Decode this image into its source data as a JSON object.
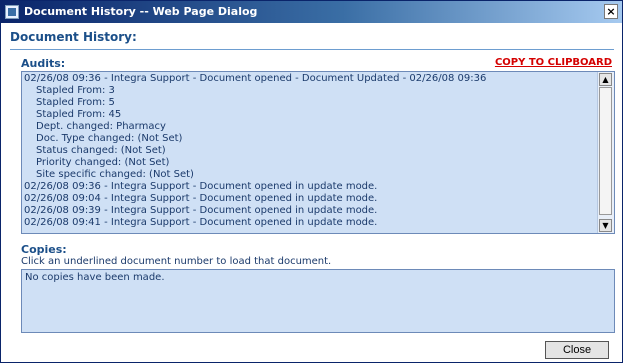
{
  "window": {
    "title": "Document History -- Web Page Dialog",
    "close_glyph": "×"
  },
  "heading": "Document History:",
  "audits": {
    "label": "Audits:",
    "copy_link": "COPY TO CLIPBOARD",
    "lines": [
      {
        "text": "02/26/08 09:36  -  Integra Support  -  Document opened  -  Document Updated  -  02/26/08 09:36",
        "indent": false
      },
      {
        "text": "Stapled From:   3",
        "indent": true
      },
      {
        "text": "Stapled From:   5",
        "indent": true
      },
      {
        "text": "Stapled From:   45",
        "indent": true
      },
      {
        "text": "Dept. changed:  Pharmacy",
        "indent": true
      },
      {
        "text": "Doc. Type changed:  (Not Set)",
        "indent": true
      },
      {
        "text": "Status changed:  (Not Set)",
        "indent": true
      },
      {
        "text": "Priority changed:  (Not Set)",
        "indent": true
      },
      {
        "text": "Site specific changed:  (Not Set)",
        "indent": true
      },
      {
        "text": "02/26/08 09:36  -  Integra Support  -  Document opened in update mode.",
        "indent": false
      },
      {
        "text": "02/26/08 09:04  -  Integra Support  -  Document opened in update mode.",
        "indent": false
      },
      {
        "text": "02/26/08 09:39  -  Integra Support  -  Document opened in update mode.",
        "indent": false
      },
      {
        "text": "02/26/08 09:41  -  Integra Support  -  Document opened in update mode.",
        "indent": false
      }
    ],
    "scroll_up_glyph": "▲",
    "scroll_down_glyph": "▼"
  },
  "copies": {
    "label": "Copies:",
    "instruction": "Click an underlined document number to load that document.",
    "content": "No copies have been made."
  },
  "buttons": {
    "close_label": "Close"
  }
}
